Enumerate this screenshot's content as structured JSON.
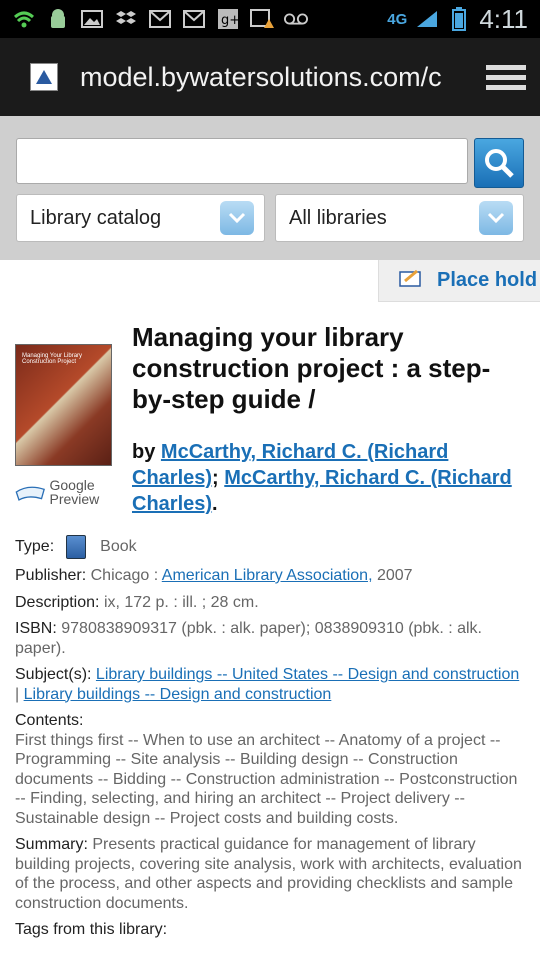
{
  "status": {
    "time": "4:11",
    "network": "4G",
    "icons": [
      "wifi-icon",
      "android-icon",
      "image-icon",
      "dropbox-icon",
      "gmail-icon",
      "gmail-icon",
      "gplus-icon",
      "media-warning-icon",
      "voicemail-icon"
    ]
  },
  "browser": {
    "url": "model.bywatersolutions.com/c"
  },
  "search": {
    "query": "",
    "scope": "Library catalog",
    "library": "All libraries"
  },
  "actions": {
    "place_hold": "Place hold"
  },
  "record": {
    "title": "Managing your library construction project : a step-by-step guide /",
    "by_prefix": "by",
    "author1": "McCarthy, Richard C. (Richard Charles)",
    "author_sep": ";",
    "author2": "McCarthy, Richard C. (Richard Charles)",
    "by_end": ".",
    "cover_text": "Managing Your Library Construction Project",
    "google_preview": "Google Preview",
    "type_label": "Type:",
    "type_value": "Book",
    "publisher_label": "Publisher:",
    "publisher_place": "Chicago :",
    "publisher_name": "American Library Association,",
    "publisher_year": "2007",
    "description_label": "Description:",
    "description_value": "ix, 172 p. : ill. ; 28 cm.",
    "isbn_label": "ISBN:",
    "isbn_value": "9780838909317 (pbk. : alk. paper); 0838909310 (pbk. : alk. paper).",
    "subjects_label": "Subject(s):",
    "subject1": "Library buildings -- United States -- Design and construction",
    "subject_sep": "|",
    "subject2": "Library buildings -- Design and construction",
    "contents_label": "Contents:",
    "contents_value": "First things first -- When to use an architect -- Anatomy of a project -- Programming -- Site analysis -- Building design -- Construction documents -- Bidding -- Construction administration -- Postconstruction -- Finding, selecting, and hiring an architect -- Project delivery -- Sustainable design -- Project costs and building costs.",
    "summary_label": "Summary:",
    "summary_value": "Presents practical guidance for management of library building projects, covering site analysis, work with architects, evaluation of the process, and other aspects and providing checklists and sample construction documents.",
    "tags_label": "Tags from this library:"
  }
}
